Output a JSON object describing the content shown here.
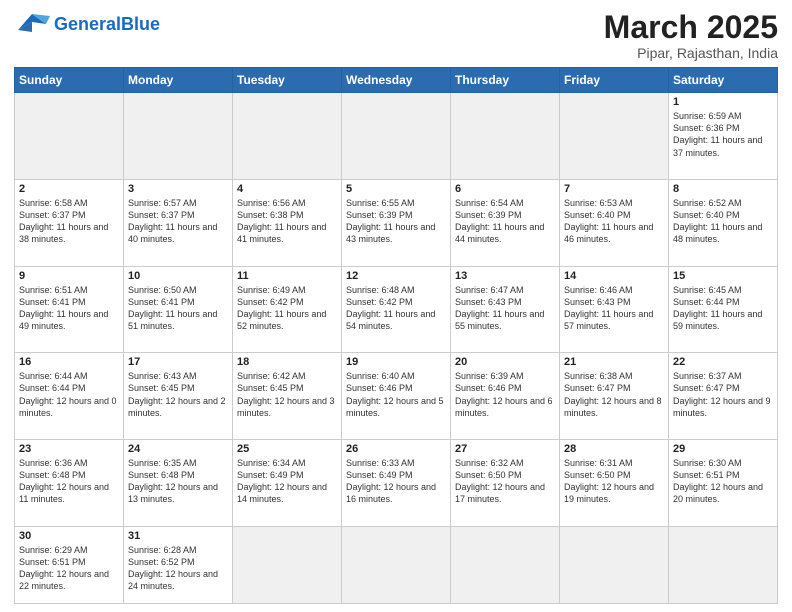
{
  "header": {
    "logo_general": "General",
    "logo_blue": "Blue",
    "month_title": "March 2025",
    "location": "Pipar, Rajasthan, India"
  },
  "days_of_week": [
    "Sunday",
    "Monday",
    "Tuesday",
    "Wednesday",
    "Thursday",
    "Friday",
    "Saturday"
  ],
  "weeks": [
    [
      {
        "day": "",
        "empty": true
      },
      {
        "day": "",
        "empty": true
      },
      {
        "day": "",
        "empty": true
      },
      {
        "day": "",
        "empty": true
      },
      {
        "day": "",
        "empty": true
      },
      {
        "day": "",
        "empty": true
      },
      {
        "day": "1",
        "sunrise": "6:59 AM",
        "sunset": "6:36 PM",
        "daylight": "11 hours and 37 minutes."
      }
    ],
    [
      {
        "day": "2",
        "sunrise": "6:58 AM",
        "sunset": "6:37 PM",
        "daylight": "11 hours and 38 minutes."
      },
      {
        "day": "3",
        "sunrise": "6:57 AM",
        "sunset": "6:37 PM",
        "daylight": "11 hours and 40 minutes."
      },
      {
        "day": "4",
        "sunrise": "6:56 AM",
        "sunset": "6:38 PM",
        "daylight": "11 hours and 41 minutes."
      },
      {
        "day": "5",
        "sunrise": "6:55 AM",
        "sunset": "6:39 PM",
        "daylight": "11 hours and 43 minutes."
      },
      {
        "day": "6",
        "sunrise": "6:54 AM",
        "sunset": "6:39 PM",
        "daylight": "11 hours and 44 minutes."
      },
      {
        "day": "7",
        "sunrise": "6:53 AM",
        "sunset": "6:40 PM",
        "daylight": "11 hours and 46 minutes."
      },
      {
        "day": "8",
        "sunrise": "6:52 AM",
        "sunset": "6:40 PM",
        "daylight": "11 hours and 48 minutes."
      }
    ],
    [
      {
        "day": "9",
        "sunrise": "6:51 AM",
        "sunset": "6:41 PM",
        "daylight": "11 hours and 49 minutes."
      },
      {
        "day": "10",
        "sunrise": "6:50 AM",
        "sunset": "6:41 PM",
        "daylight": "11 hours and 51 minutes."
      },
      {
        "day": "11",
        "sunrise": "6:49 AM",
        "sunset": "6:42 PM",
        "daylight": "11 hours and 52 minutes."
      },
      {
        "day": "12",
        "sunrise": "6:48 AM",
        "sunset": "6:42 PM",
        "daylight": "11 hours and 54 minutes."
      },
      {
        "day": "13",
        "sunrise": "6:47 AM",
        "sunset": "6:43 PM",
        "daylight": "11 hours and 55 minutes."
      },
      {
        "day": "14",
        "sunrise": "6:46 AM",
        "sunset": "6:43 PM",
        "daylight": "11 hours and 57 minutes."
      },
      {
        "day": "15",
        "sunrise": "6:45 AM",
        "sunset": "6:44 PM",
        "daylight": "11 hours and 59 minutes."
      }
    ],
    [
      {
        "day": "16",
        "sunrise": "6:44 AM",
        "sunset": "6:44 PM",
        "daylight": "12 hours and 0 minutes."
      },
      {
        "day": "17",
        "sunrise": "6:43 AM",
        "sunset": "6:45 PM",
        "daylight": "12 hours and 2 minutes."
      },
      {
        "day": "18",
        "sunrise": "6:42 AM",
        "sunset": "6:45 PM",
        "daylight": "12 hours and 3 minutes."
      },
      {
        "day": "19",
        "sunrise": "6:40 AM",
        "sunset": "6:46 PM",
        "daylight": "12 hours and 5 minutes."
      },
      {
        "day": "20",
        "sunrise": "6:39 AM",
        "sunset": "6:46 PM",
        "daylight": "12 hours and 6 minutes."
      },
      {
        "day": "21",
        "sunrise": "6:38 AM",
        "sunset": "6:47 PM",
        "daylight": "12 hours and 8 minutes."
      },
      {
        "day": "22",
        "sunrise": "6:37 AM",
        "sunset": "6:47 PM",
        "daylight": "12 hours and 9 minutes."
      }
    ],
    [
      {
        "day": "23",
        "sunrise": "6:36 AM",
        "sunset": "6:48 PM",
        "daylight": "12 hours and 11 minutes."
      },
      {
        "day": "24",
        "sunrise": "6:35 AM",
        "sunset": "6:48 PM",
        "daylight": "12 hours and 13 minutes."
      },
      {
        "day": "25",
        "sunrise": "6:34 AM",
        "sunset": "6:49 PM",
        "daylight": "12 hours and 14 minutes."
      },
      {
        "day": "26",
        "sunrise": "6:33 AM",
        "sunset": "6:49 PM",
        "daylight": "12 hours and 16 minutes."
      },
      {
        "day": "27",
        "sunrise": "6:32 AM",
        "sunset": "6:50 PM",
        "daylight": "12 hours and 17 minutes."
      },
      {
        "day": "28",
        "sunrise": "6:31 AM",
        "sunset": "6:50 PM",
        "daylight": "12 hours and 19 minutes."
      },
      {
        "day": "29",
        "sunrise": "6:30 AM",
        "sunset": "6:51 PM",
        "daylight": "12 hours and 20 minutes."
      }
    ],
    [
      {
        "day": "30",
        "sunrise": "6:29 AM",
        "sunset": "6:51 PM",
        "daylight": "12 hours and 22 minutes."
      },
      {
        "day": "31",
        "sunrise": "6:28 AM",
        "sunset": "6:52 PM",
        "daylight": "12 hours and 24 minutes."
      },
      {
        "day": "",
        "empty": true
      },
      {
        "day": "",
        "empty": true
      },
      {
        "day": "",
        "empty": true
      },
      {
        "day": "",
        "empty": true
      },
      {
        "day": "",
        "empty": true
      }
    ]
  ]
}
